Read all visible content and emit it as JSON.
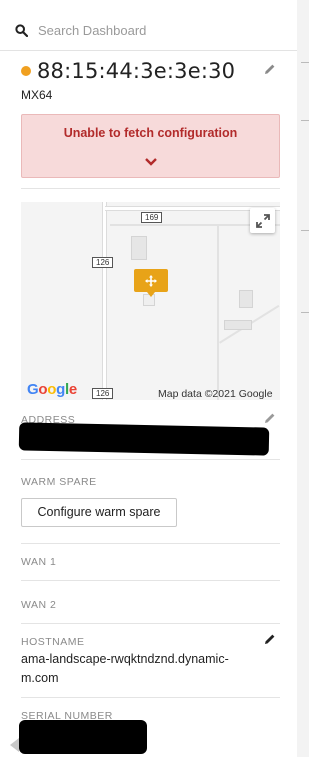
{
  "search": {
    "placeholder": "Search Dashboard"
  },
  "device": {
    "name": "88:15:44:3e:3e:30",
    "model": "MX64",
    "status_color": "#f0a020"
  },
  "alert": {
    "message": "Unable to fetch configuration"
  },
  "map": {
    "route_shields": [
      "169",
      "126",
      "126"
    ],
    "logo": "Google",
    "logo_colors": [
      "#4285f4",
      "#ea4335",
      "#fbbc05",
      "#4285f4",
      "#34a853",
      "#ea4335"
    ],
    "attribution": "Map data ©2021 Google",
    "pin_color": "#e8a318"
  },
  "fields": {
    "address_label": "ADDRESS",
    "warm_spare_label": "WARM SPARE",
    "warm_spare_button": "Configure warm spare",
    "wan1_label": "WAN 1",
    "wan2_label": "WAN 2",
    "hostname_label": "HOSTNAME",
    "hostname_line1": "ama-landscape-rwqktndznd.dynamic-",
    "hostname_line2": "m.com",
    "serial_label": "SERIAL NUMBER"
  },
  "icons": {
    "search": "search-icon",
    "edit": "pencil-icon",
    "chevron": "chevron-down-icon",
    "expand": "fullscreen-icon",
    "pin": "device-pin-icon"
  }
}
